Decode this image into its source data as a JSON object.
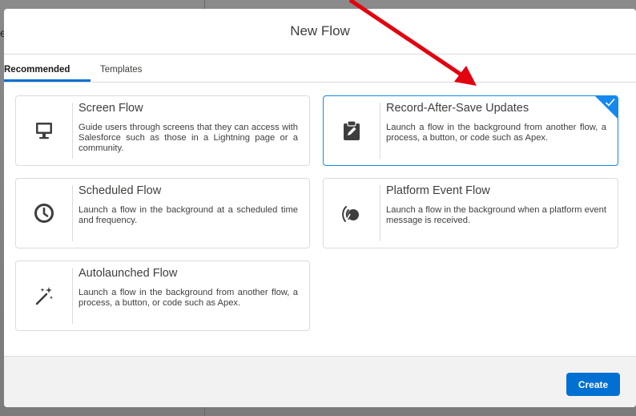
{
  "backdrop": {
    "clipped_letter": "e"
  },
  "modal": {
    "title": "New Flow"
  },
  "tabs": [
    {
      "label": "Recommended",
      "active": true
    },
    {
      "label": "Templates",
      "active": false
    }
  ],
  "cards": [
    {
      "title": "Screen Flow",
      "description": "Guide users through screens that they can access with Salesforce such as those in a Lightning page or a community.",
      "icon": "desktop-icon",
      "selected": false
    },
    {
      "title": "Record-After-Save Updates",
      "description": "Launch a flow in the background from another flow, a process, a button, or code such as Apex.",
      "icon": "clipboard-edit-icon",
      "selected": true
    },
    {
      "title": "Scheduled Flow",
      "description": "Launch a flow in the background at a scheduled time and frequency.",
      "icon": "clock-icon",
      "selected": false
    },
    {
      "title": "Platform Event Flow",
      "description": "Launch a flow in the background when a platform event message is received.",
      "icon": "broadcast-icon",
      "selected": false
    },
    {
      "title": "Autolaunched Flow",
      "description": "Launch a flow in the background from another flow, a process, a button, or code such as Apex.",
      "icon": "magic-wand-icon",
      "selected": false
    }
  ],
  "footer": {
    "create_label": "Create"
  },
  "colors": {
    "brand": "#0070d2",
    "selected_border": "#1589ee",
    "annotation_arrow": "#e3000f",
    "icon": "#3e3e3c"
  }
}
